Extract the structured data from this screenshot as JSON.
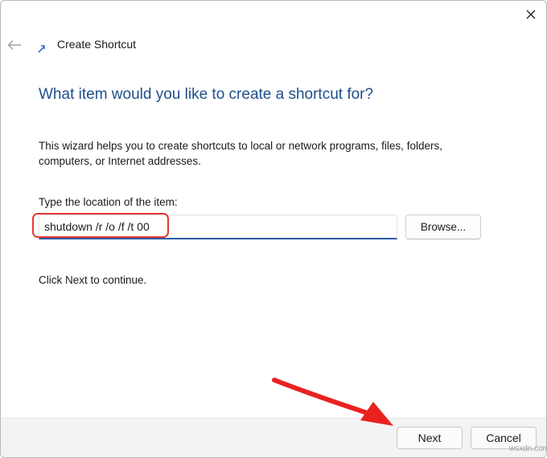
{
  "window": {
    "title": "Create Shortcut"
  },
  "wizard": {
    "heading": "What item would you like to create a shortcut for?",
    "description": "This wizard helps you to create shortcuts to local or network programs, files, folders, computers, or Internet addresses.",
    "field_label": "Type the location of the item:",
    "location_value": "shutdown /r /o /f /t 00",
    "browse_label": "Browse...",
    "continue_hint": "Click Next to continue."
  },
  "footer": {
    "next_label": "Next",
    "cancel_label": "Cancel"
  },
  "annotation": {
    "highlight_color": "#e53935",
    "arrow_color": "#e8221f"
  },
  "icons": {
    "close": "close-icon",
    "back": "back-arrow-icon",
    "title": "shortcut-icon"
  },
  "watermark": "wsxdn.com"
}
